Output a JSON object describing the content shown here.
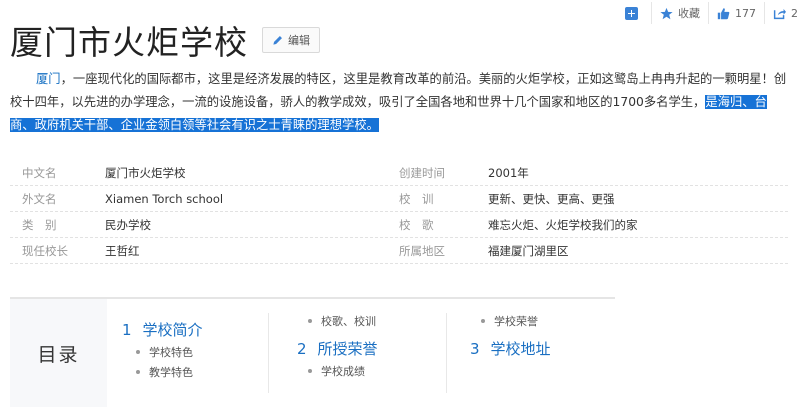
{
  "toolbar": {
    "favorite_label": "收藏",
    "like_count": "177",
    "share_count": "2"
  },
  "header": {
    "title": "厦门市火炬学校",
    "edit_label": "编辑"
  },
  "intro": {
    "link_text": "厦门",
    "text_1": "，一座现代化的国际都市，这里是经济发展的特区，这里是教育改革的前沿。美丽的火炬学校，正如这鹭岛上冉冉升起的一颗明星！创校十四年，以先进的办学理念，一流的设施设备，骄人的教学成效，吸引了全国各地和世界十几个国家和地区的1700多名学生，",
    "highlighted_text": "是海归、台商、政府机关干部、企业金领白领等社会有识之士青睐的理想学校。"
  },
  "info": {
    "rows": [
      {
        "k1": "中文名",
        "v1": "厦门市火炬学校",
        "k2": "创建时间",
        "v2": "2001年"
      },
      {
        "k1": "外文名",
        "v1": "Xiamen Torch school",
        "k2": "校　训",
        "v2": "更新、更快、更高、更强"
      },
      {
        "k1": "类　别",
        "v1": "民办学校",
        "k2": "校　歌",
        "v2": "难忘火炬、火炬学校我们的家"
      },
      {
        "k1": "现任校长",
        "v1": "王哲红",
        "k2": "所属地区",
        "v2": "福建厦门湖里区"
      }
    ]
  },
  "catalog": {
    "label": "目录",
    "col1": {
      "num": "1",
      "title": "学校简介",
      "subs": [
        "学校特色",
        "教学特色"
      ]
    },
    "col2": {
      "pre_subs": [
        "校歌、校训"
      ],
      "num": "2",
      "title": "所授荣誉",
      "subs": [
        "学校成绩"
      ]
    },
    "col3": {
      "pre_subs": [
        "学校荣誉"
      ],
      "num": "3",
      "title": "学校地址"
    }
  }
}
